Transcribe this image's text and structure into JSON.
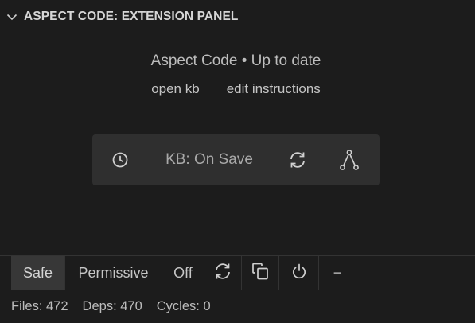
{
  "panel": {
    "title": "ASPECT CODE: EXTENSION PANEL",
    "status": "Aspect Code • Up to date",
    "links": {
      "open_kb": "open kb",
      "edit_instructions": "edit instructions"
    }
  },
  "kb_bar": {
    "label": "KB: On Save",
    "icons": [
      "clock-icon",
      "refresh-icon",
      "graph-icon"
    ]
  },
  "toolbar": {
    "modes": [
      "Safe",
      "Permissive",
      "Off"
    ],
    "active_mode": "Safe",
    "icons": [
      "refresh-icon",
      "copy-icon",
      "power-icon",
      "minus-icon"
    ],
    "minus_label": "−"
  },
  "stats": {
    "files": "Files: 472",
    "deps": "Deps: 470",
    "cycles": "Cycles: 0"
  },
  "colors": {
    "background": "#1c1c1c",
    "bar_background": "#2f2f2f",
    "active_button": "#373737",
    "text": "#cccccc"
  }
}
